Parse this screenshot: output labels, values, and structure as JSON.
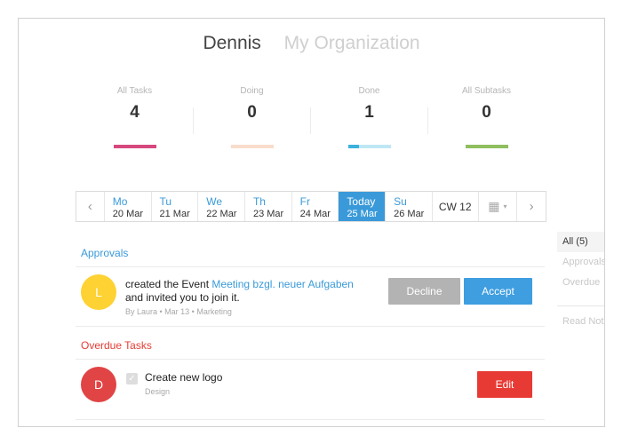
{
  "header": {
    "user": "Dennis",
    "org": "My Organization"
  },
  "stats": [
    {
      "label": "All Tasks",
      "value": "4"
    },
    {
      "label": "Doing",
      "value": "0"
    },
    {
      "label": "Done",
      "value": "1"
    },
    {
      "label": "All Subtasks",
      "value": "0"
    }
  ],
  "calendar": {
    "days": [
      {
        "name": "Mo",
        "date": "20 Mar"
      },
      {
        "name": "Tu",
        "date": "21 Mar"
      },
      {
        "name": "We",
        "date": "22 Mar"
      },
      {
        "name": "Th",
        "date": "23 Mar"
      },
      {
        "name": "Fr",
        "date": "24 Mar"
      },
      {
        "name": "Today",
        "date": "25 Mar"
      },
      {
        "name": "Su",
        "date": "26 Mar"
      }
    ],
    "week": "CW 12",
    "prev_icon": "‹",
    "next_icon": "›",
    "cal_icon": "▦",
    "cal_caret": "▾"
  },
  "approvals": {
    "title": "Approvals",
    "avatar": "L",
    "msg_before": "created the Event ",
    "msg_link": "Meeting bzgl. neuer Aufgaben",
    "msg_after": " and invited you to join it.",
    "meta": "By Laura • Mar 13 • Marketing",
    "decline": "Decline",
    "accept": "Accept"
  },
  "overdue": {
    "title": "Overdue Tasks",
    "avatar": "D",
    "check": "✓",
    "task": "Create new logo",
    "category": "Design",
    "edit": "Edit"
  },
  "sidebar": {
    "items": [
      "All (5)",
      "Approvals",
      "Overdue"
    ],
    "footer": "Read Not"
  },
  "colors": {
    "accent": "#3a9ad9",
    "all_tasks_bar": "#d6487e",
    "doing_bar": "#f9dccb",
    "done_bar_light": "#bfe7f3",
    "done_bar_dark": "#3bb2dd",
    "subtasks_bar": "#8fbf5f",
    "overdue": "#e53d35",
    "avatar_yellow": "#fdd232",
    "avatar_red": "#e04444",
    "decline_button": "#b3b3b3",
    "accept_button": "#3e9ee0",
    "edit_button": "#e83a34"
  },
  "progress": {
    "done_fraction": 0.25
  }
}
